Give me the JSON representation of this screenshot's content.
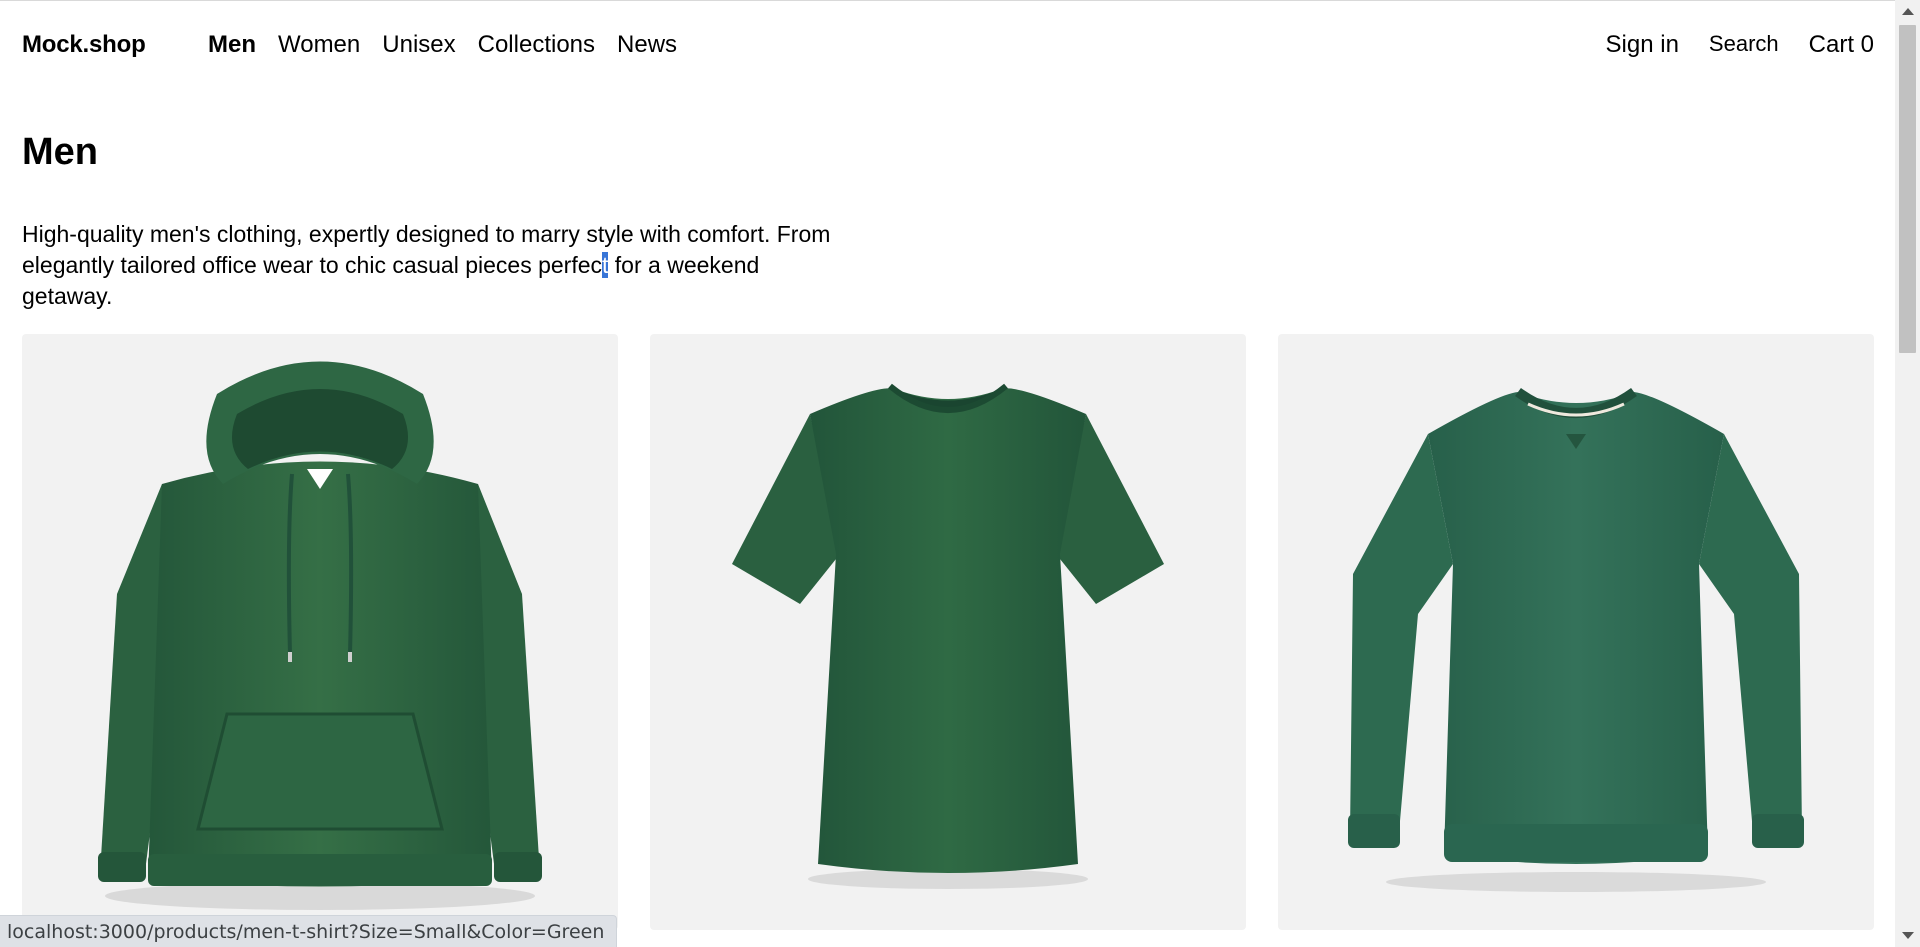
{
  "header": {
    "logo": "Mock.shop",
    "nav": [
      {
        "label": "Men",
        "active": true
      },
      {
        "label": "Women",
        "active": false
      },
      {
        "label": "Unisex",
        "active": false
      },
      {
        "label": "Collections",
        "active": false
      },
      {
        "label": "News",
        "active": false
      }
    ],
    "sign_in": "Sign in",
    "search": "Search",
    "cart": "Cart 0"
  },
  "page": {
    "title": "Men",
    "description_before": "High-quality men's clothing, expertly designed to marry style with comfort. From elegantly tailored office wear to chic casual pieces perfec",
    "description_selected": "t",
    "description_after": " for a weekend getaway."
  },
  "products": [
    {
      "icon": "green-hoodie-image"
    },
    {
      "icon": "green-t-shirt-image"
    },
    {
      "icon": "green-crewneck-sweatshirt-image"
    }
  ],
  "status_bar": {
    "url": "localhost:3000/products/men-t-shirt?Size=Small&Color=Green"
  },
  "colors": {
    "garment_green": "#2f6a42",
    "card_bg": "#f2f2f2",
    "selection": "#3875d7"
  }
}
